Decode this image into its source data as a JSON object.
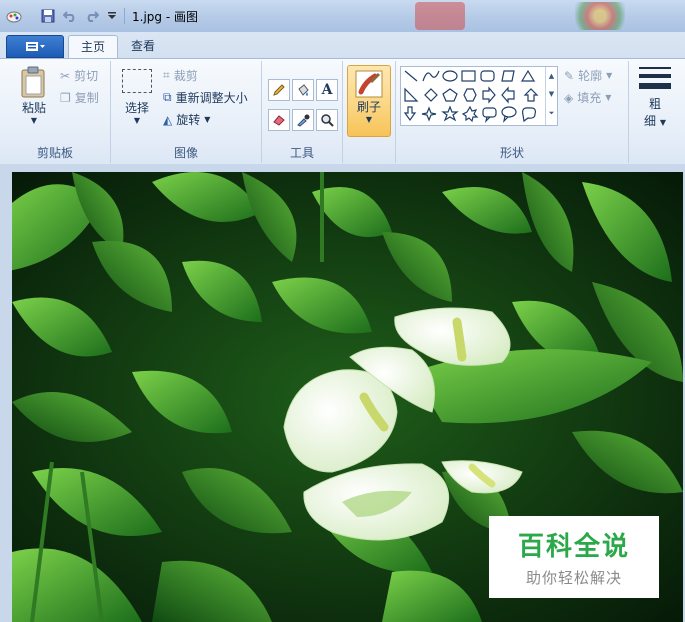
{
  "titlebar": {
    "title": "1.jpg - 画图"
  },
  "tabs": {
    "home": "主页",
    "view": "查看"
  },
  "clipboard": {
    "paste": "粘贴",
    "cut": "剪切",
    "copy": "复制",
    "group": "剪贴板"
  },
  "image": {
    "select": "选择",
    "crop": "裁剪",
    "resize": "重新调整大小",
    "rotate": "旋转",
    "group": "图像"
  },
  "tools": {
    "group": "工具"
  },
  "brushes": {
    "label": "刷子"
  },
  "shapes": {
    "outline": "轮廓",
    "fill": "填充",
    "group": "形状"
  },
  "size": {
    "label_line1": "粗",
    "label_line2": "细"
  },
  "watermark": {
    "title": "百科全说",
    "subtitle": "助你轻松解决"
  },
  "colors": {
    "accent": "#1d5cb5",
    "brush_active": "#fbd98b"
  }
}
